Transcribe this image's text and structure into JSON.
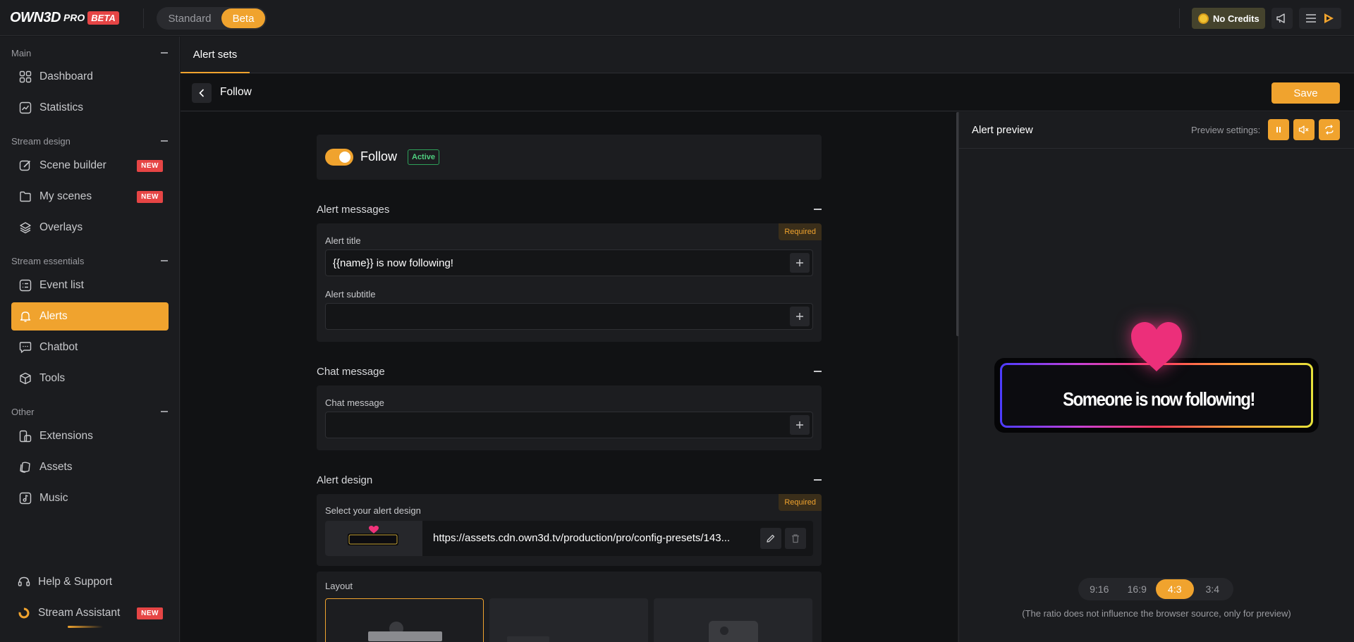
{
  "header": {
    "logo_brand": "OWN3D",
    "logo_pro": "PRO",
    "logo_beta": "BETA",
    "mode_standard": "Standard",
    "mode_beta": "Beta",
    "credits": "No Credits"
  },
  "sidebar": {
    "sections": [
      {
        "title": "Main"
      },
      {
        "title": "Stream design"
      },
      {
        "title": "Stream essentials"
      },
      {
        "title": "Other"
      }
    ],
    "items": [
      {
        "label": "Dashboard",
        "icon": "grid-icon"
      },
      {
        "label": "Statistics",
        "icon": "chart-icon"
      },
      {
        "label": "Scene builder",
        "icon": "brush-icon",
        "badge": "NEW"
      },
      {
        "label": "My scenes",
        "icon": "folder-icon",
        "badge": "NEW"
      },
      {
        "label": "Overlays",
        "icon": "layers-icon"
      },
      {
        "label": "Event list",
        "icon": "list-icon"
      },
      {
        "label": "Alerts",
        "icon": "bell-icon",
        "active": true
      },
      {
        "label": "Chatbot",
        "icon": "chat-icon"
      },
      {
        "label": "Tools",
        "icon": "box-icon"
      },
      {
        "label": "Extensions",
        "icon": "puzzle-icon"
      },
      {
        "label": "Assets",
        "icon": "assets-icon"
      },
      {
        "label": "Music",
        "icon": "music-icon"
      }
    ],
    "help": "Help & Support",
    "assistant": "Stream Assistant",
    "assistant_badge": "NEW"
  },
  "tabs": {
    "alert_sets": "Alert sets"
  },
  "subheader": {
    "title": "Follow",
    "save": "Save"
  },
  "editor": {
    "follow_label": "Follow",
    "active_badge": "Active",
    "alert_messages": {
      "title": "Alert messages",
      "required": "Required",
      "alert_title_label": "Alert title",
      "alert_title_value": "{{name}} is now following!",
      "alert_subtitle_label": "Alert subtitle",
      "alert_subtitle_value": ""
    },
    "chat_message": {
      "title": "Chat message",
      "label": "Chat message",
      "value": ""
    },
    "alert_design": {
      "title": "Alert design",
      "required": "Required",
      "label": "Select your alert design",
      "url": "https://assets.cdn.own3d.tv/production/pro/config-presets/143..."
    },
    "layout": {
      "label": "Layout"
    }
  },
  "preview": {
    "title": "Alert preview",
    "settings_label": "Preview settings:",
    "alert_text": "Someone is now following!",
    "ratios": [
      "9:16",
      "16:9",
      "4:3",
      "3:4"
    ],
    "selected_ratio": "4:3",
    "ratio_note": "(The ratio does not influence the browser source, only for preview)"
  },
  "colors": {
    "accent": "#f0a32e",
    "new_badge": "#e64545",
    "active_badge": "#4fcf7f"
  }
}
